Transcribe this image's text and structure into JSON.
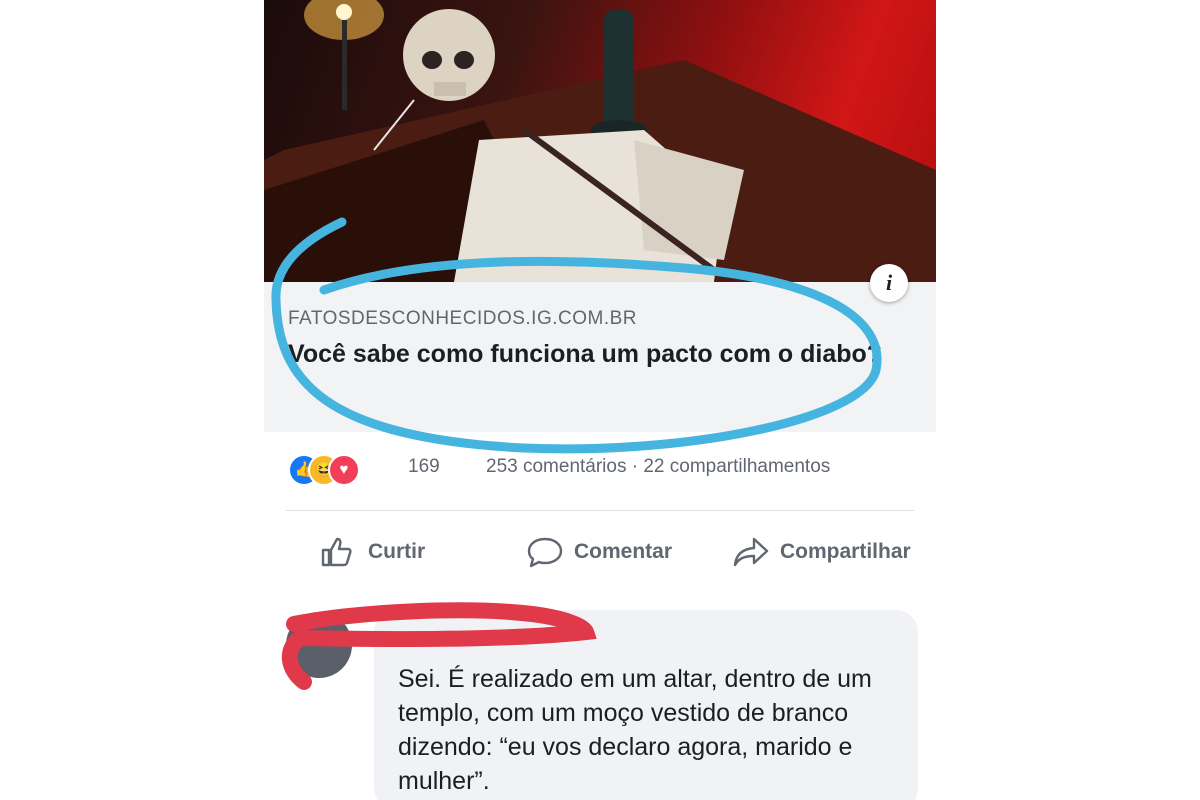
{
  "post": {
    "hero_image": "devil-pact-altar-photo",
    "link_domain": "FATOSDESCONHECIDOS.IG.COM.BR",
    "link_title": "Você sabe como funciona um pacto com o diabo?",
    "info_label": "i",
    "annotation_color": "#45b5e0"
  },
  "stats": {
    "reactions": [
      "like",
      "haha",
      "love"
    ],
    "reaction_count": "169",
    "comments_shares": "253 comentários · 22 compartilhamentos"
  },
  "actions": {
    "like": "Curtir",
    "comment": "Comentar",
    "share": "Compartilhar"
  },
  "comment": {
    "author": "",
    "text": "Sei. É realizado em um altar, dentro de um templo, com um moço vestido de branco dizendo: “eu vos declaro agora, marido e mulher”.",
    "redaction_color": "#e0394a"
  },
  "colors": {
    "facebook_blue": "#1877f2",
    "text_dark": "#1c1e21",
    "text_gray": "#606770"
  }
}
